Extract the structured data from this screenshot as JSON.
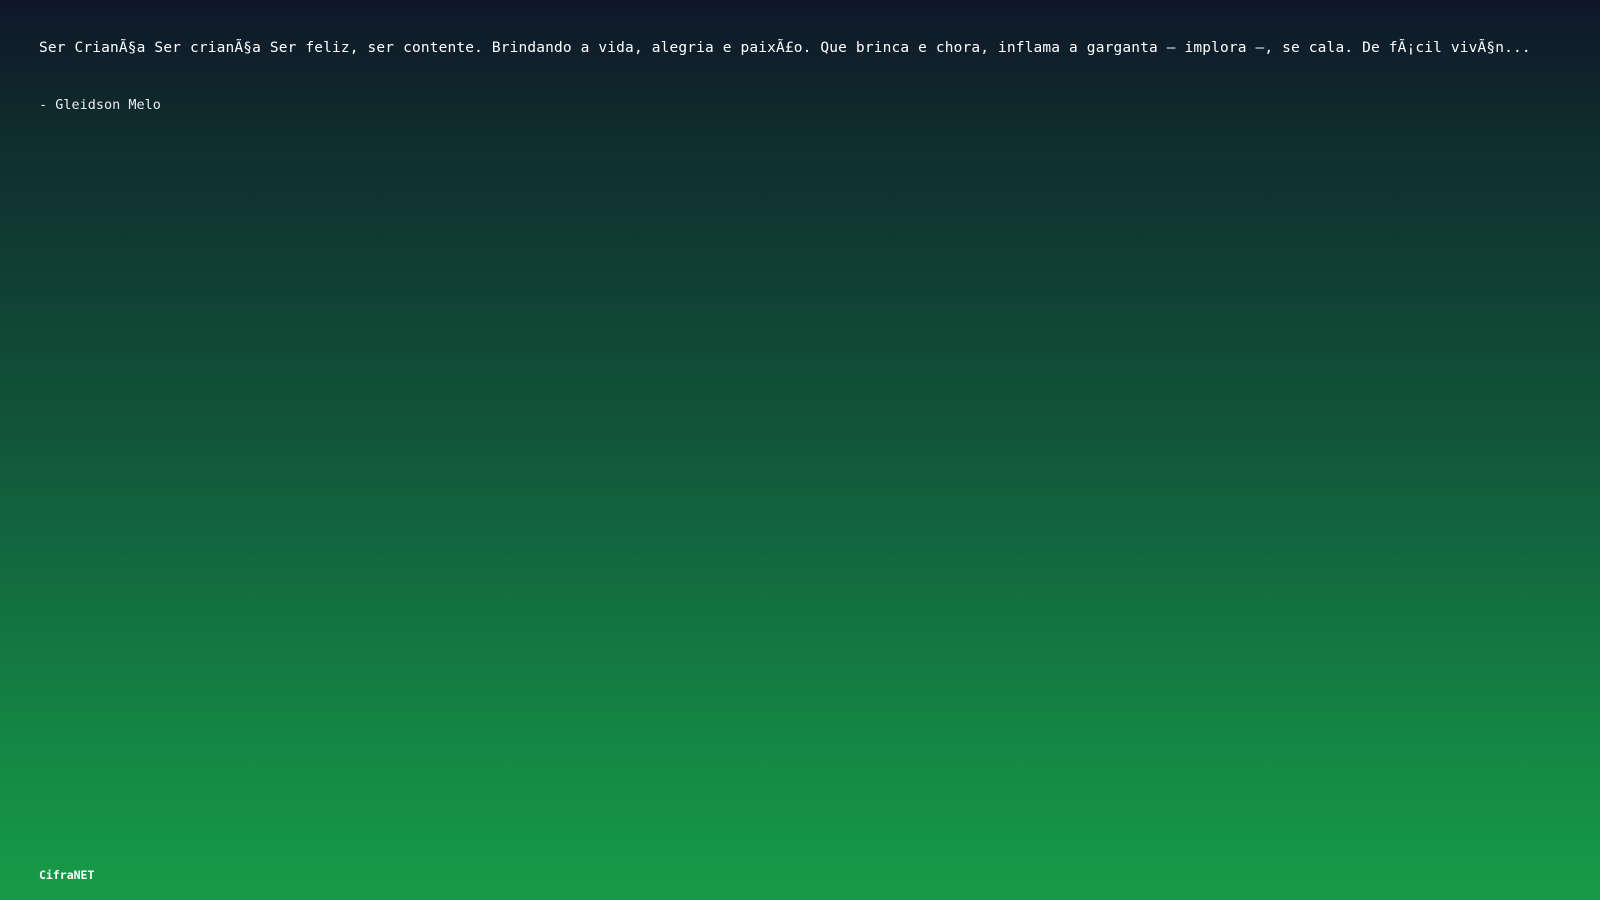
{
  "quote": {
    "text": "Ser CrianÃ§a Ser crianÃ§a Ser feliz, ser contente. Brindando a vida, alegria e paixÃ£o. Que brinca e chora, inflama a garganta — implora —, se cala. De fÃ¡cil vivÃ§n...",
    "author": "- Gleidson Melo"
  },
  "branding": {
    "name": "CifraNET"
  },
  "colors": {
    "gradient_top": "#0f172a",
    "gradient_bottom": "#169c48",
    "text": "#ffffff"
  }
}
